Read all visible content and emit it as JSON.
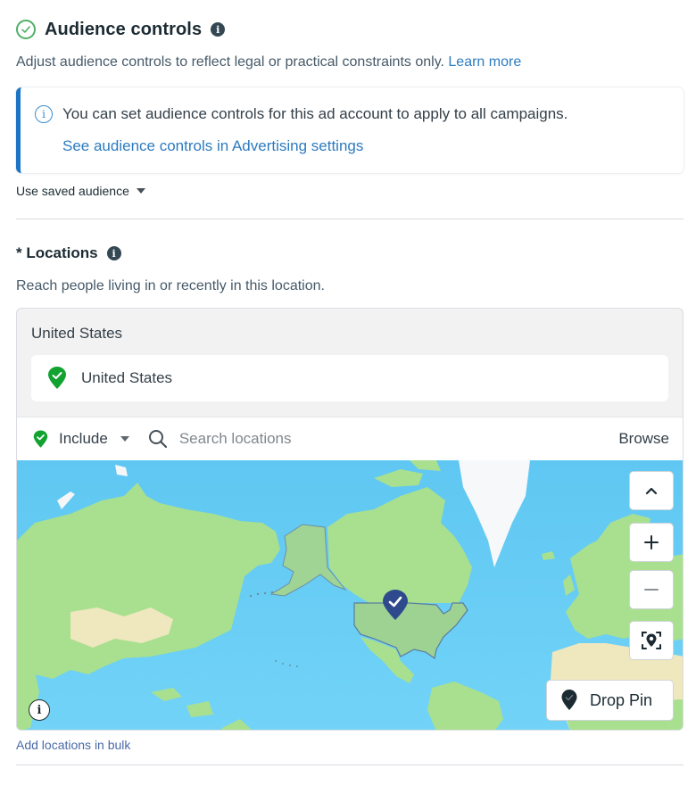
{
  "audience_controls": {
    "title": "Audience controls",
    "info_icon": "info-icon",
    "status_icon": "check-circle-icon",
    "description": "Adjust audience controls to reflect legal or practical constraints only.",
    "learn_more": "Learn more",
    "banner": {
      "icon": "info-circle-icon",
      "text": "You can set audience controls for this ad account to apply to all campaigns.",
      "link": "See audience controls in Advertising settings",
      "accent_color": "#1b74c4"
    },
    "saved_audience_label": "Use saved audience"
  },
  "locations": {
    "title": "* Locations",
    "description": "Reach people living in or recently in this location.",
    "group_header": "United States",
    "selected": [
      {
        "name": "United States",
        "type": "include",
        "icon": "green-check-pin-icon"
      }
    ],
    "include_mode": "Include",
    "search_placeholder": "Search locations",
    "browse_label": "Browse",
    "map": {
      "pin_marker": "blue-check-pin-icon",
      "highlighted_region": "United States",
      "controls": {
        "collapse": "chevron-up-icon",
        "zoom_in": "plus-icon",
        "zoom_out": "minus-icon",
        "locate": "locate-pin-icon"
      },
      "drop_pin_label": "Drop Pin",
      "info_icon": "info-icon"
    },
    "bulk_link": "Add locations in bulk"
  },
  "colors": {
    "link": "#2d7bbf",
    "include_green": "#12a230",
    "map_water": "#6ccff6",
    "map_land": "#a8e08f",
    "pin_blue": "#2e4a8c"
  }
}
